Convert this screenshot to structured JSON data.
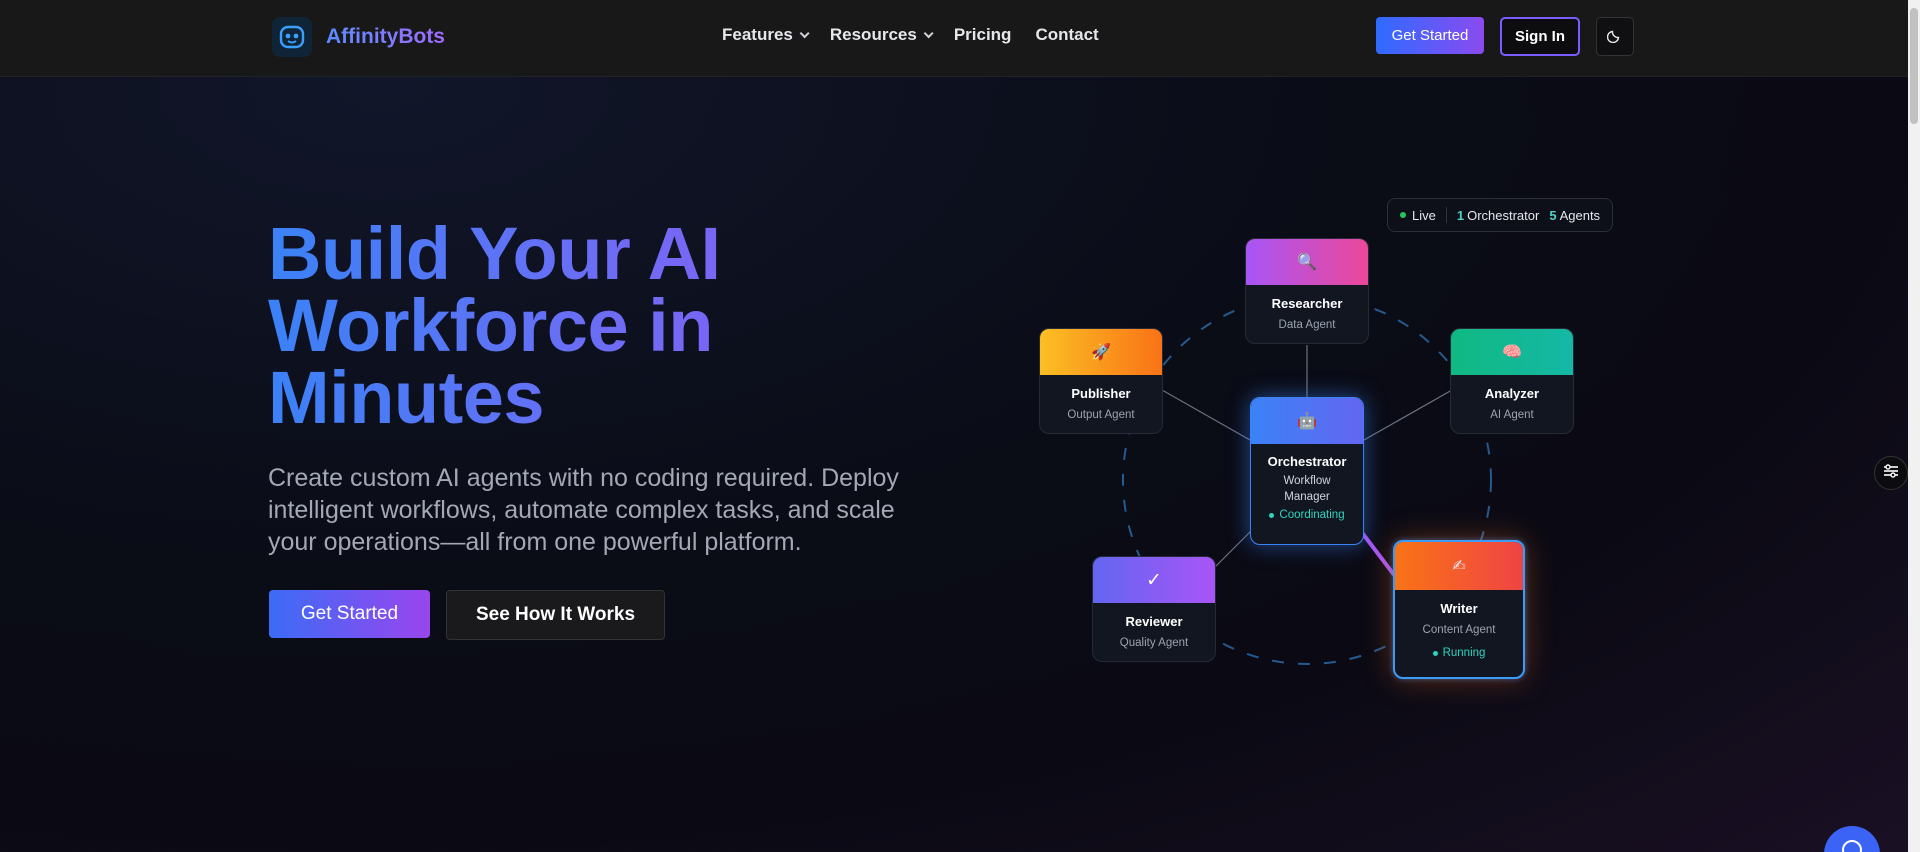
{
  "brand": {
    "name": "AffinityBots",
    "logo_icon": "robot-face-icon"
  },
  "nav": {
    "links": [
      {
        "label": "Features",
        "has_dropdown": true
      },
      {
        "label": "Resources",
        "has_dropdown": true
      },
      {
        "label": "Pricing",
        "has_dropdown": false
      },
      {
        "label": "Contact",
        "has_dropdown": false
      }
    ],
    "get_started": "Get Started",
    "sign_in": "Sign In",
    "theme_icon": "moon-icon"
  },
  "hero": {
    "title": "Build Your AI Workforce in Minutes",
    "subtitle": "Create custom AI agents with no coding required. Deploy intelligent workflows, automate complex tasks, and scale your operations—all from one powerful platform.",
    "primary_cta": "Get Started",
    "secondary_cta": "See How It Works"
  },
  "diagram": {
    "status": {
      "live": "Live",
      "orchestrators": "1",
      "orchestrators_label": "Orchestrator",
      "agents": "5",
      "agents_label": "Agents"
    },
    "agents": {
      "researcher": {
        "icon": "🔍",
        "title": "Researcher",
        "sub": "Data Agent"
      },
      "analyzer": {
        "icon": "🧠",
        "title": "Analyzer",
        "sub": "AI Agent"
      },
      "publisher": {
        "icon": "🚀",
        "title": "Publisher",
        "sub": "Output Agent"
      },
      "orchestrator": {
        "icon": "🤖",
        "title": "Orchestrator",
        "sub": "Workflow Manager",
        "status": "Coordinating"
      },
      "reviewer": {
        "icon": "✓",
        "title": "Reviewer",
        "sub": "Quality Agent"
      },
      "writer": {
        "icon": "✍",
        "title": "Writer",
        "sub": "Content Agent",
        "status": "Running"
      }
    }
  },
  "colors": {
    "brand_blue": "#3b82f6",
    "brand_purple": "#8b5cf6",
    "status_teal": "#2dd4bf"
  }
}
